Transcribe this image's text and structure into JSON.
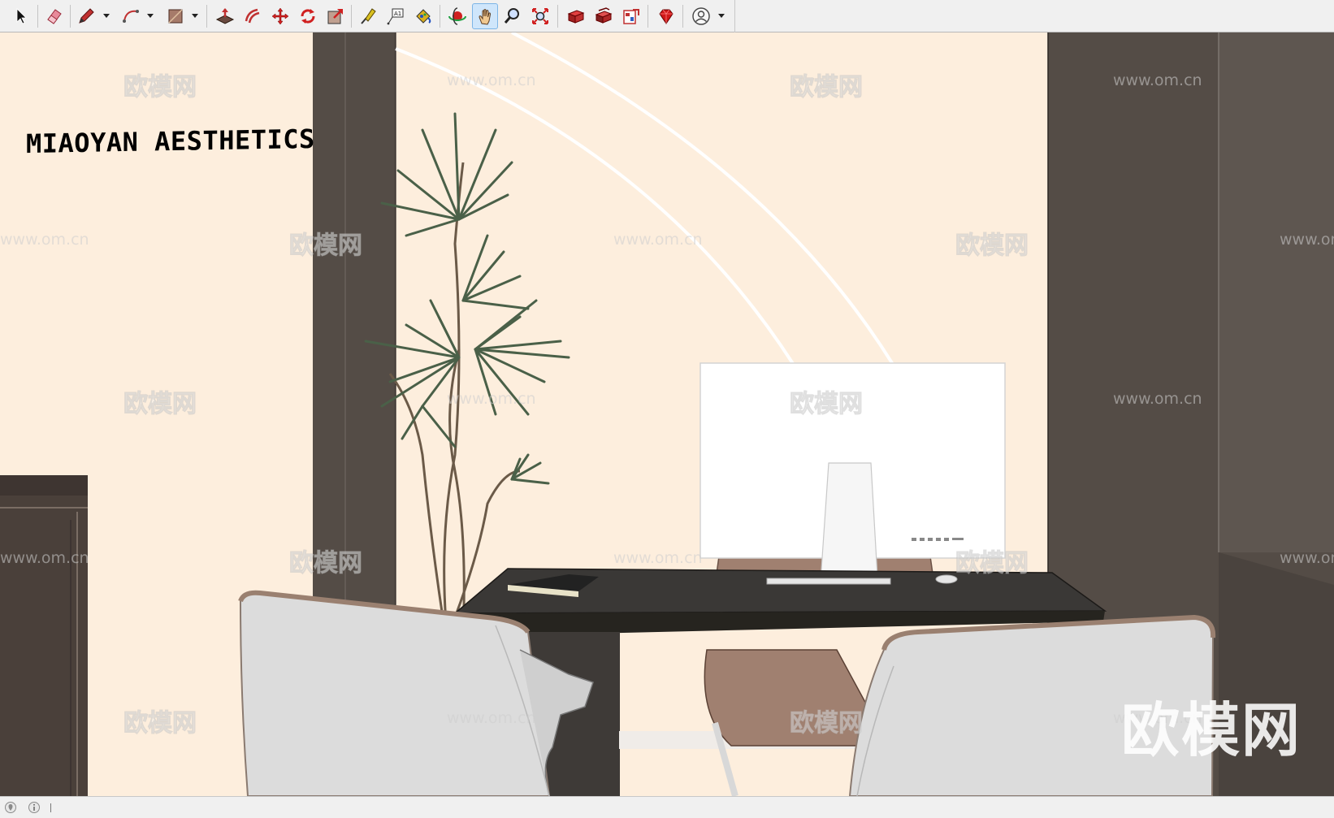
{
  "toolbar": {
    "tools": [
      {
        "name": "select-tool",
        "icon": "select-arrow-icon"
      },
      {
        "name": "eraser-tool",
        "icon": "eraser-icon"
      },
      {
        "name": "line-tool",
        "icon": "pencil-icon",
        "has_dropdown": true
      },
      {
        "name": "arc-tool",
        "icon": "arc-icon",
        "has_dropdown": true
      },
      {
        "name": "shape-tool",
        "icon": "rectangle-icon",
        "has_dropdown": true
      },
      {
        "name": "push-pull-tool",
        "icon": "push-pull-icon"
      },
      {
        "name": "offset-tool",
        "icon": "offset-icon"
      },
      {
        "name": "move-tool",
        "icon": "move-icon"
      },
      {
        "name": "rotate-tool",
        "icon": "rotate-icon"
      },
      {
        "name": "scale-tool",
        "icon": "scale-icon"
      },
      {
        "name": "tape-measure-tool",
        "icon": "tape-measure-icon"
      },
      {
        "name": "text-tool",
        "icon": "text-label-icon"
      },
      {
        "name": "paint-bucket-tool",
        "icon": "paint-bucket-icon"
      },
      {
        "name": "orbit-tool",
        "icon": "orbit-icon"
      },
      {
        "name": "pan-tool",
        "icon": "hand-icon",
        "active": true
      },
      {
        "name": "zoom-tool",
        "icon": "magnifier-icon"
      },
      {
        "name": "zoom-extents-tool",
        "icon": "zoom-extents-icon"
      },
      {
        "name": "3d-warehouse-button",
        "icon": "warehouse-icon"
      },
      {
        "name": "extension-warehouse-button",
        "icon": "extension-icon"
      },
      {
        "name": "send-to-layout-button",
        "icon": "layout-icon"
      },
      {
        "name": "extension-manager-button",
        "icon": "ruby-gem-icon"
      },
      {
        "name": "account-button",
        "icon": "user-account-icon",
        "has_dropdown": true
      }
    ]
  },
  "scene": {
    "brand_text": "MIAOYAN AESTHETICS",
    "watermark_logo": "欧模网",
    "watermark_cn": "欧模网",
    "watermark_url": "www.om.cn"
  },
  "status_bar": {
    "icons": [
      "geo-location-icon",
      "info-icon"
    ]
  },
  "colors": {
    "wall": "#fdeedd",
    "dark_column": "#544c46",
    "desk_top": "#3a3836",
    "chair_shell": "#dcdcdc",
    "chair_leather": "#a08070",
    "active_tool_bg": "#cfe6fb",
    "toolbar_bg": "#f0f0f0"
  }
}
